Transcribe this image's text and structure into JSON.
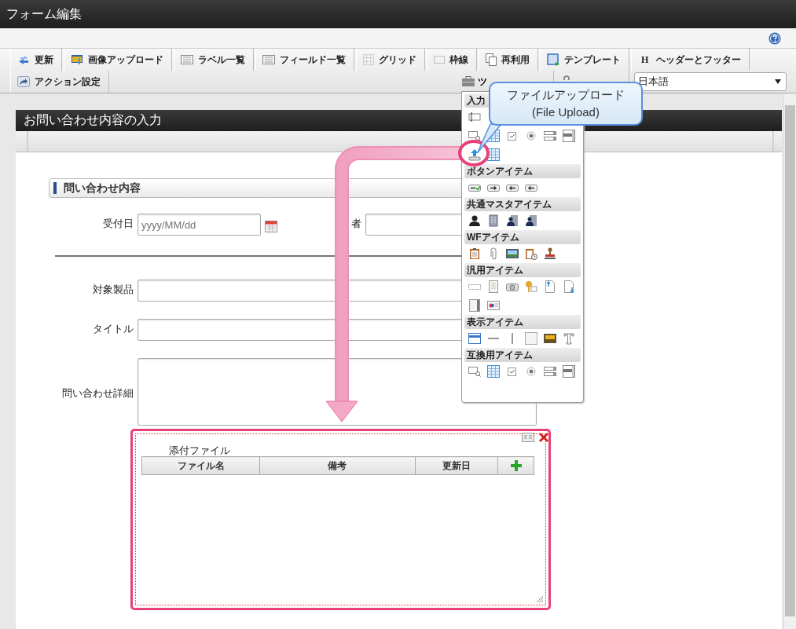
{
  "window": {
    "title": "フォーム編集"
  },
  "toolbar": {
    "row_1": [
      {
        "label": "更新"
      },
      {
        "label": "画像アップロード"
      },
      {
        "label": "ラベル一覧"
      },
      {
        "label": "フィールド一覧"
      },
      {
        "label": "グリッド"
      },
      {
        "label": "枠線"
      },
      {
        "label": "再利用"
      },
      {
        "label": "テンプレート"
      },
      {
        "label": "ヘッダーとフッター",
        "glyph": "H"
      }
    ],
    "row_2": [
      {
        "label": "アクション設定"
      }
    ],
    "toolkit_tab": "ツ",
    "language": "日本語"
  },
  "form": {
    "title": "お問い合わせ内容の入力",
    "section": "問い合わせ内容",
    "top_row": [
      {
        "label": "受付日",
        "placeholder": "yyyy/MM/dd",
        "kind": "date"
      },
      {
        "label": "者",
        "kind": "text"
      }
    ],
    "fields": [
      {
        "label": "対象製品",
        "kind": "text"
      },
      {
        "label": "タイトル",
        "kind": "text"
      },
      {
        "label": "問い合わせ詳細",
        "kind": "textarea"
      }
    ],
    "attachment": {
      "label": "添付ファイル",
      "columns": [
        "ファイル名",
        "備考",
        "更新日"
      ]
    }
  },
  "palette": {
    "sections": [
      {
        "title": "入力"
      },
      {
        "title": "ボタンアイテム"
      },
      {
        "title": "共通マスタアイテム"
      },
      {
        "title": "WFアイテム"
      },
      {
        "title": "汎用アイテム"
      },
      {
        "title": "表示アイテム"
      },
      {
        "title": "互換用アイテム"
      }
    ]
  },
  "callout": {
    "lines": [
      "ファイルアップロード",
      "(File Upload)"
    ]
  }
}
